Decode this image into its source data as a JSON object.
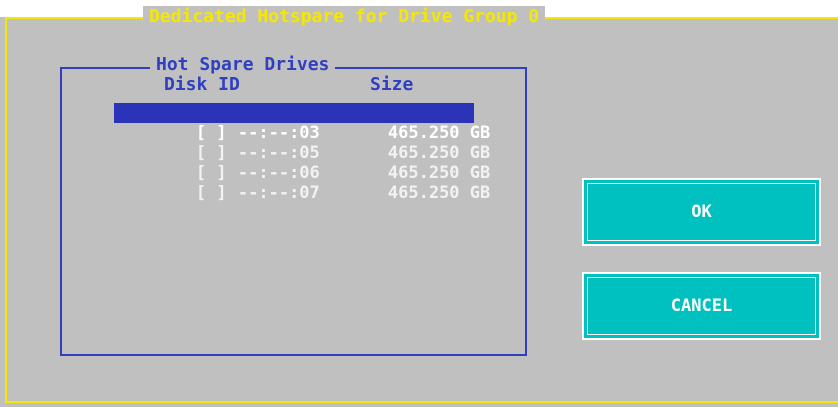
{
  "dialog": {
    "title": "Dedicated Hotspare for Drive Group 0"
  },
  "group": {
    "title": "Hot Spare Drives",
    "columns": {
      "disk_id": "Disk ID",
      "size": "Size"
    }
  },
  "drives": [
    {
      "checkbox": "[ ]",
      "disk_id": "--:--:03",
      "size": "465.250 GB",
      "selected": true
    },
    {
      "checkbox": "[ ]",
      "disk_id": "--:--:05",
      "size": "465.250 GB",
      "selected": false
    },
    {
      "checkbox": "[ ]",
      "disk_id": "--:--:06",
      "size": "465.250 GB",
      "selected": false
    },
    {
      "checkbox": "[ ]",
      "disk_id": "--:--:07",
      "size": "465.250 GB",
      "selected": false
    }
  ],
  "buttons": {
    "ok_label": "OK",
    "cancel_label": "CANCEL"
  },
  "colors": {
    "frame": "#f5e800",
    "group_border": "#2f3fbf",
    "selection": "#2b34b8",
    "button_bg": "#00c0c0",
    "background": "#c0c0c0"
  }
}
